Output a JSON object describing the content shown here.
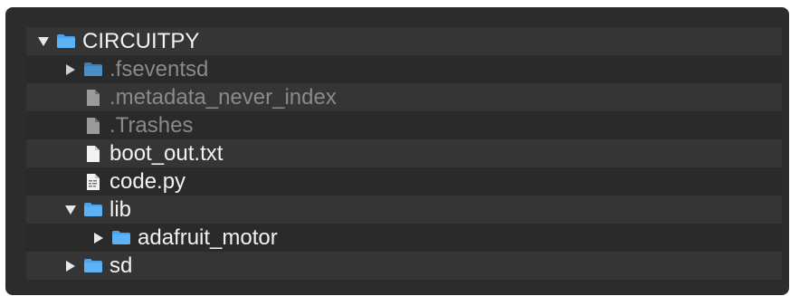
{
  "colors": {
    "panel_bg": "#2c2c2c",
    "row_even": "#353535",
    "row_odd": "#2a2a2a",
    "text": "#f2f2f2",
    "text_dim": "#8a8a8a",
    "folder_blue": "#4aa3ee"
  },
  "tree": {
    "items": [
      {
        "label": "CIRCUITPY",
        "depth": 0,
        "kind": "folder",
        "disclosure": "expanded",
        "icon": "folder-icon",
        "dimmed": false
      },
      {
        "label": ".fseventsd",
        "depth": 1,
        "kind": "folder",
        "disclosure": "collapsed",
        "icon": "folder-icon",
        "dimmed": true
      },
      {
        "label": ".metadata_never_index",
        "depth": 1,
        "kind": "file",
        "disclosure": "none",
        "icon": "document-icon",
        "dimmed": true
      },
      {
        "label": ".Trashes",
        "depth": 1,
        "kind": "file",
        "disclosure": "none",
        "icon": "document-icon",
        "dimmed": true
      },
      {
        "label": "boot_out.txt",
        "depth": 1,
        "kind": "file",
        "disclosure": "none",
        "icon": "document-icon",
        "dimmed": false
      },
      {
        "label": "code.py",
        "depth": 1,
        "kind": "file",
        "disclosure": "none",
        "icon": "python-file-icon",
        "dimmed": false
      },
      {
        "label": "lib",
        "depth": 1,
        "kind": "folder",
        "disclosure": "expanded",
        "icon": "folder-icon",
        "dimmed": false
      },
      {
        "label": "adafruit_motor",
        "depth": 2,
        "kind": "folder",
        "disclosure": "collapsed",
        "icon": "folder-icon",
        "dimmed": false
      },
      {
        "label": "sd",
        "depth": 1,
        "kind": "folder",
        "disclosure": "collapsed",
        "icon": "folder-icon",
        "dimmed": false
      }
    ]
  }
}
